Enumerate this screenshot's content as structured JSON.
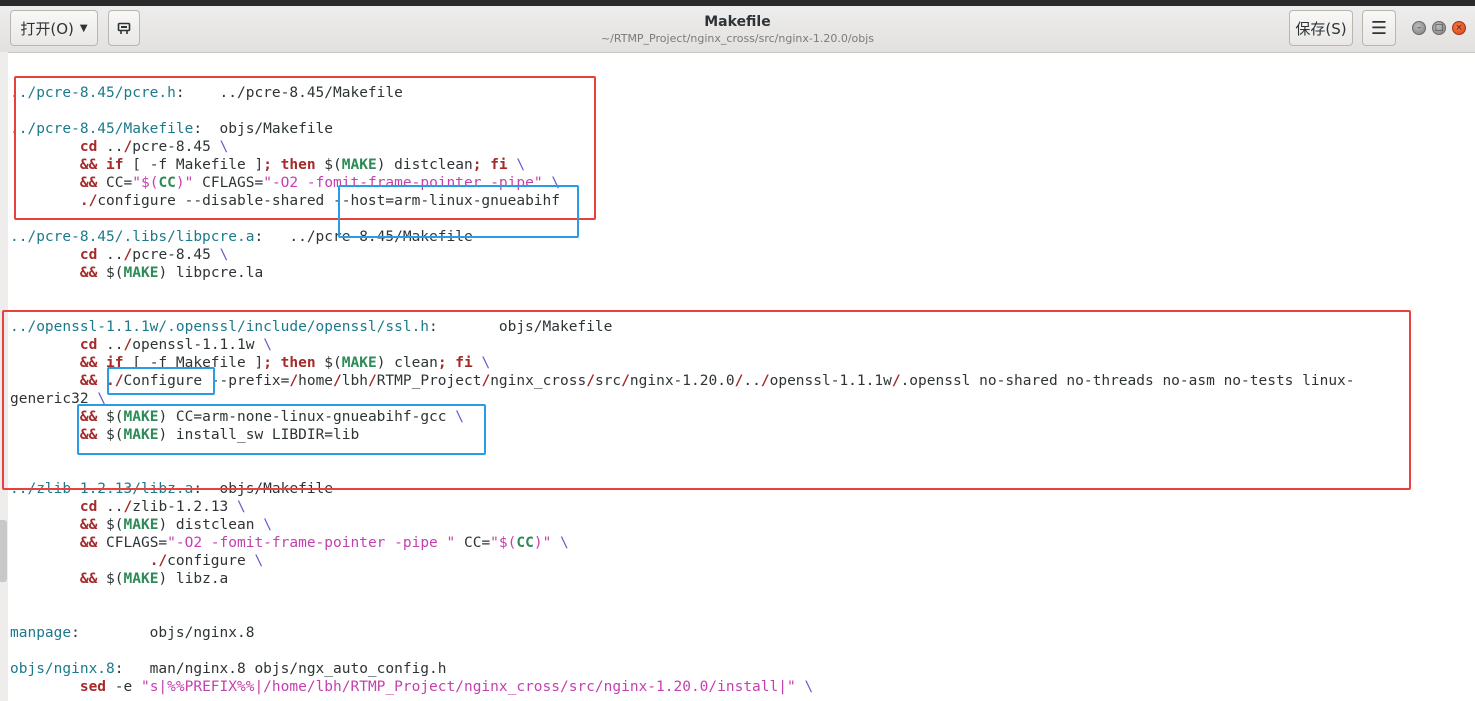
{
  "header": {
    "open_label": "打开(O)",
    "title": "Makefile",
    "subtitle": "~/RTMP_Project/nginx_cross/src/nginx-1.20.0/objs",
    "save_label": "保存(S)",
    "menu_icon": "hamburger-icon",
    "pin_icon": "pin-document-icon"
  },
  "lines": [
    "../pcre-8.45/pcre.h:    ../pcre-8.45/Makefile",
    "",
    "../pcre-8.45/Makefile:  objs/Makefile",
    "        cd ../pcre-8.45 \\",
    "        && if [ -f Makefile ]; then $(MAKE) distclean; fi \\",
    "        && CC=\"$(CC)\" CFLAGS=\"-O2 -fomit-frame-pointer -pipe\" \\",
    "        ./configure --disable-shared --host=arm-linux-gnueabihf",
    "",
    "../pcre-8.45/.libs/libpcre.a:   ../pcre-8.45/Makefile",
    "        cd ../pcre-8.45 \\",
    "        && $(MAKE) libpcre.la",
    "",
    "",
    "../openssl-1.1.1w/.openssl/include/openssl/ssl.h:       objs/Makefile",
    "        cd ../openssl-1.1.1w \\",
    "        && if [ -f Makefile ]; then $(MAKE) clean; fi \\",
    "        && ./Configure --prefix=/home/lbh/RTMP_Project/nginx_cross/src/nginx-1.20.0/../openssl-1.1.1w/.openssl no-shared no-threads no-asm no-tests linux-",
    "generic32 \\",
    "        && $(MAKE) CC=arm-none-linux-gnueabihf-gcc \\",
    "        && $(MAKE) install_sw LIBDIR=lib",
    "",
    "",
    "../zlib-1.2.13/libz.a:  objs/Makefile",
    "        cd ../zlib-1.2.13 \\",
    "        && $(MAKE) distclean \\",
    "        && CFLAGS=\"-O2 -fomit-frame-pointer -pipe \" CC=\"$(CC)\" \\",
    "                ./configure \\",
    "        && $(MAKE) libz.a",
    "",
    "",
    "manpage:        objs/nginx.8",
    "",
    "objs/nginx.8:   man/nginx.8 objs/ngx_auto_config.h",
    "        sed -e \"s|%%PREFIX%%|/home/lbh/RTMP_Project/nginx_cross/src/nginx-1.20.0/install|\" \\"
  ]
}
